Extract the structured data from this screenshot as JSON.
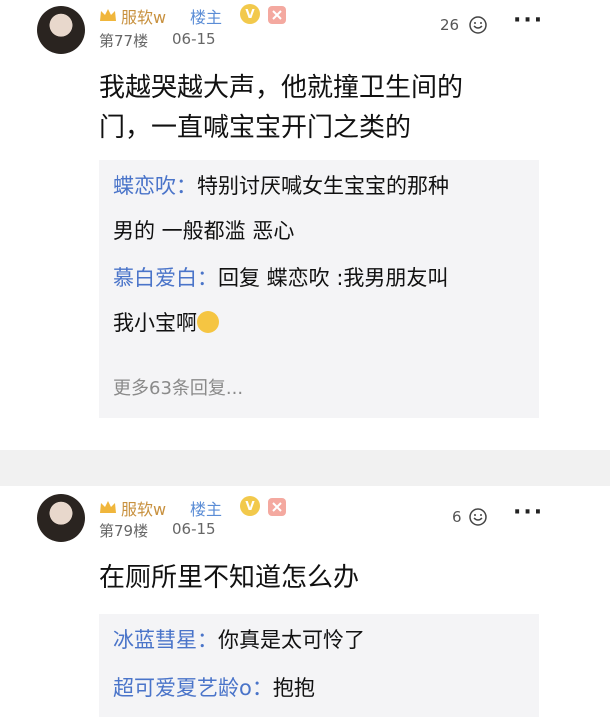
{
  "posts": [
    {
      "username": "服软w",
      "owner_tag": "楼主",
      "level_badge": "V",
      "floor": "第77楼",
      "date": "06-15",
      "likes": "26",
      "content_line1": "我越哭越大声，他就撞卫生间的",
      "content_line2": "门，一直喊宝宝开门之类的",
      "replies": [
        {
          "name": "蝶恋吹",
          "sep": "：",
          "text_line1": "特别讨厌喊女生宝宝的那种",
          "text_line2": "男的 一般都滥 恶心"
        },
        {
          "name": "慕白爱白",
          "sep": "：",
          "text_line1": "回复 蝶恋吹 :我男朋友叫",
          "text_line2": "我小宝啊"
        }
      ],
      "more_replies": "更多63条回复..."
    },
    {
      "username": "服软w",
      "owner_tag": "楼主",
      "level_badge": "V",
      "floor": "第79楼",
      "date": "06-15",
      "likes": "6",
      "content_line1": "在厕所里不知道怎么办",
      "replies": [
        {
          "name": "冰蓝彗星",
          "sep": "：",
          "text_line1": "你真是太可怜了"
        },
        {
          "name": "超可爱夏艺龄o",
          "sep": "：",
          "text_line1": "抱抱"
        }
      ]
    }
  ],
  "icons": {
    "crown": "crown-icon",
    "like": "like-icon",
    "more": "more-icon",
    "emoji": "crying-emoji-icon"
  },
  "colors": {
    "username": "#c8913f",
    "reply_name": "#4a74c9",
    "owner_tag": "#5b8dd6"
  }
}
